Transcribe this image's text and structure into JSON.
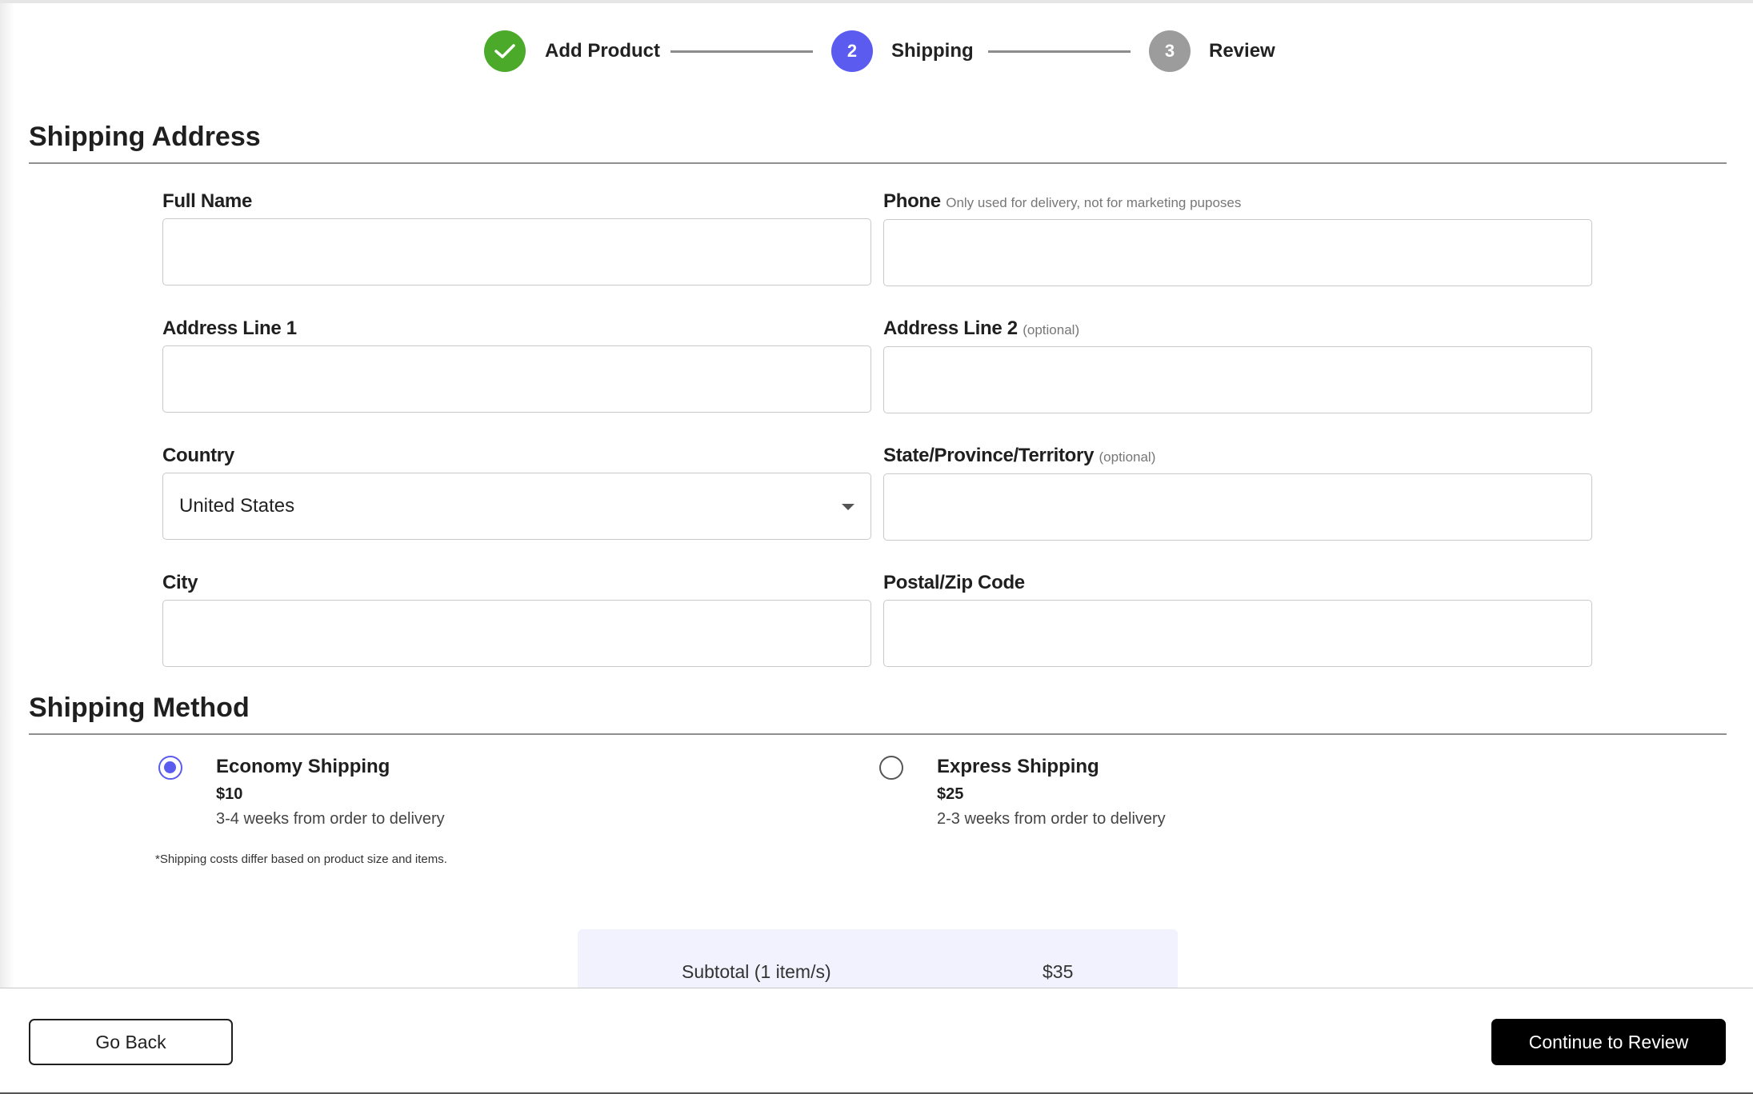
{
  "stepper": {
    "steps": [
      {
        "number": "",
        "label": "Add Product",
        "state": "done",
        "icon": "check-icon"
      },
      {
        "number": "2",
        "label": "Shipping",
        "state": "active"
      },
      {
        "number": "3",
        "label": "Review",
        "state": "pending"
      }
    ]
  },
  "shipping_address": {
    "title": "Shipping Address",
    "full_name": {
      "label": "Full Name",
      "value": ""
    },
    "phone": {
      "label": "Phone",
      "hint": "Only used for delivery, not for marketing puposes",
      "value": ""
    },
    "address1": {
      "label": "Address Line 1",
      "value": ""
    },
    "address2": {
      "label": "Address Line 2",
      "hint": "(optional)",
      "value": ""
    },
    "country": {
      "label": "Country",
      "selected": "United States",
      "icon": "chevron-down-icon"
    },
    "state": {
      "label": "State/Province/Territory",
      "hint": "(optional)",
      "value": ""
    },
    "city": {
      "label": "City",
      "value": ""
    },
    "postal": {
      "label": "Postal/Zip Code",
      "value": ""
    }
  },
  "shipping_method": {
    "title": "Shipping Method",
    "options": [
      {
        "name": "Economy Shipping",
        "price": "$10",
        "desc": "3-4 weeks from order to delivery",
        "selected": true
      },
      {
        "name": "Express Shipping",
        "price": "$25",
        "desc": "2-3 weeks from order to delivery",
        "selected": false
      }
    ],
    "note": "*Shipping costs differ based on product size and items."
  },
  "summary": {
    "subtotal_label": "Subtotal (1 item/s)",
    "subtotal_value": "$35"
  },
  "footer": {
    "back_label": "Go Back",
    "continue_label": "Continue to Review"
  },
  "colors": {
    "done": "#4caa2b",
    "active": "#5b5bf0",
    "pending": "#9c9c9c",
    "summary_bg": "#f1f2fd"
  }
}
